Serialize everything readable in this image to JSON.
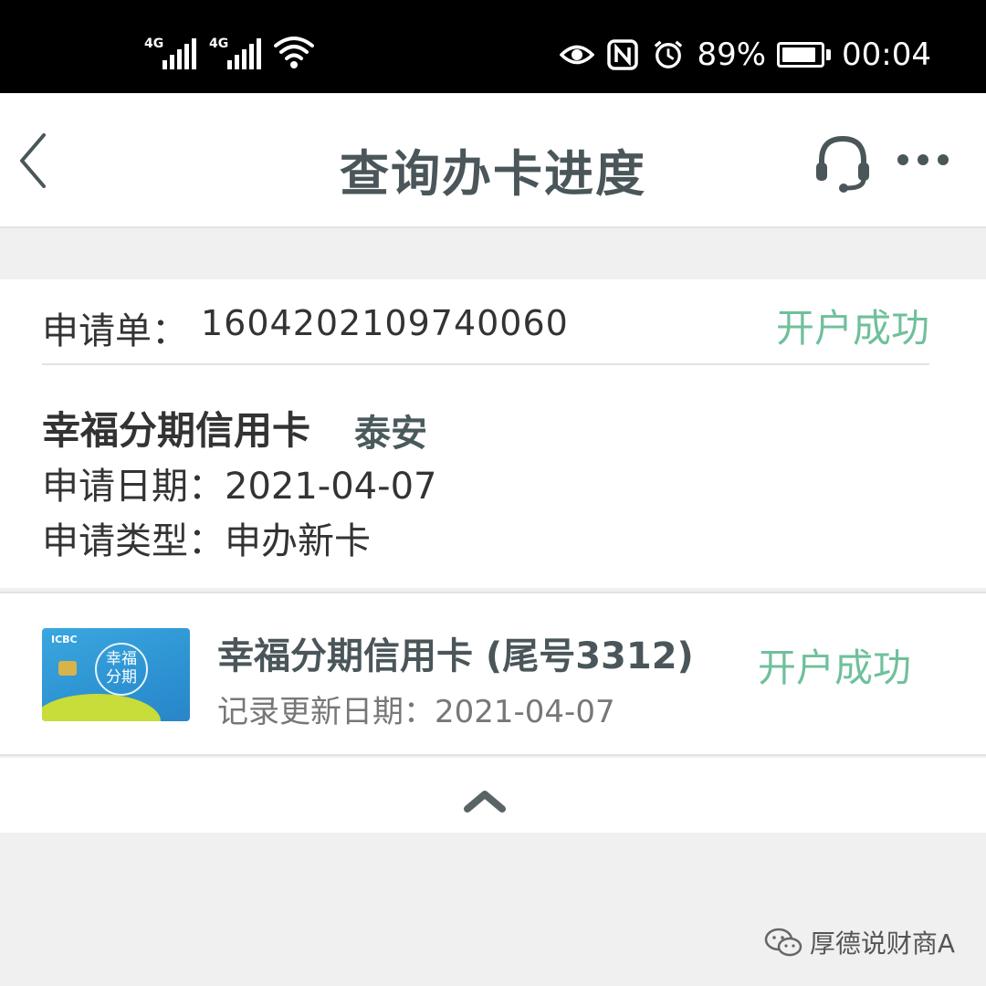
{
  "status_bar": {
    "sim1_network": "4G",
    "sim2_network": "4G",
    "battery_percent_text": "89%",
    "battery_level": 0.89,
    "time": "00:04"
  },
  "nav": {
    "title": "查询办卡进度"
  },
  "application": {
    "number_label": "申请单：",
    "number": "1604202109740060",
    "status": "开户成功",
    "card_name": "幸福分期信用卡",
    "branch": "泰安",
    "date_label": "申请日期：",
    "date": "2021-04-07",
    "type_label": "申请类型：",
    "type": "申办新卡"
  },
  "record": {
    "card_brand": "ICBC",
    "card_logo_text": "幸福分期",
    "title": "幸福分期信用卡 (尾号3312)",
    "update_label": "记录更新日期：",
    "update_date": "2021-04-07",
    "status": "开户成功"
  },
  "watermark": {
    "text": "厚德说财商A"
  },
  "colors": {
    "success": "#6fc09b",
    "title": "#4a5659",
    "background": "#f0f0f0"
  }
}
